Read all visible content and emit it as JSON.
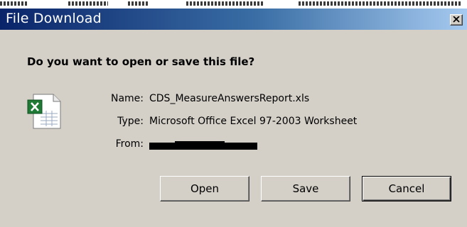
{
  "dialog": {
    "title": "File Download",
    "question": "Do you want to open or save this file?",
    "file": {
      "icon": "excel-file-icon",
      "name_label": "Name:",
      "name_value": "CDS_MeasureAnswersReport.xls",
      "type_label": "Type:",
      "type_value": "Microsoft Office Excel 97-2003 Worksheet",
      "from_label": "From:"
    },
    "buttons": {
      "open": "Open",
      "save": "Save",
      "cancel": "Cancel"
    },
    "close_icon": "close-icon"
  },
  "colors": {
    "title_gradient_start": "#0a246a",
    "title_gradient_end": "#a6caf0",
    "dialog_background": "#d4d0c8",
    "excel_green": "#1f7a35"
  }
}
